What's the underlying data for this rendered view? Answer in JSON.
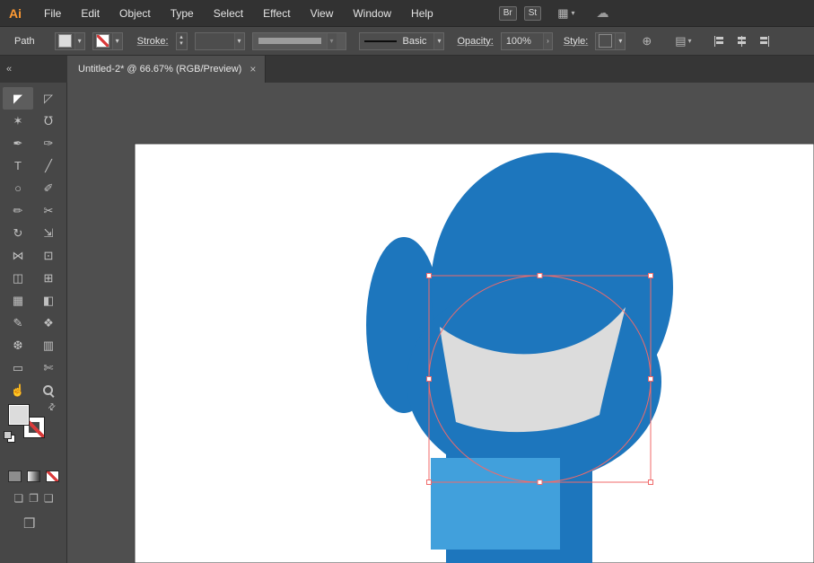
{
  "app": {
    "logo_text": "Ai"
  },
  "menubar": {
    "items": [
      {
        "label": "File"
      },
      {
        "label": "Edit"
      },
      {
        "label": "Object"
      },
      {
        "label": "Type"
      },
      {
        "label": "Select"
      },
      {
        "label": "Effect"
      },
      {
        "label": "View"
      },
      {
        "label": "Window"
      },
      {
        "label": "Help"
      }
    ],
    "buttons": [
      {
        "label": "Br"
      },
      {
        "label": "St"
      }
    ]
  },
  "controlbar": {
    "selection_label": "Path",
    "stroke_label": "Stroke:",
    "brush_label": "Basic",
    "opacity_label": "Opacity:",
    "opacity_value": "100%",
    "style_label": "Style:"
  },
  "tabbar": {
    "collapse_glyph": "«",
    "tab_title": "Untitled-2* @ 66.67% (RGB/Preview)",
    "close_glyph": "×"
  },
  "toolbar": {
    "tools": [
      {
        "name": "selection-tool",
        "glyph": "◤"
      },
      {
        "name": "direct-selection-tool",
        "glyph": "◸"
      },
      {
        "name": "magic-wand-tool",
        "glyph": "✶"
      },
      {
        "name": "lasso-tool",
        "glyph": "℧"
      },
      {
        "name": "pen-tool",
        "glyph": "✒"
      },
      {
        "name": "curvature-tool",
        "glyph": "✑"
      },
      {
        "name": "type-tool",
        "glyph": "T"
      },
      {
        "name": "line-segment-tool",
        "glyph": "╱"
      },
      {
        "name": "ellipse-tool",
        "glyph": "○"
      },
      {
        "name": "paintbrush-tool",
        "glyph": "✐"
      },
      {
        "name": "pencil-tool",
        "glyph": "✏"
      },
      {
        "name": "scissors-tool",
        "glyph": "✂"
      },
      {
        "name": "rotate-tool",
        "glyph": "↻"
      },
      {
        "name": "scale-tool",
        "glyph": "⇲"
      },
      {
        "name": "width-tool",
        "glyph": "⋈"
      },
      {
        "name": "free-transform-tool",
        "glyph": "⊡"
      },
      {
        "name": "shape-builder-tool",
        "glyph": "◫"
      },
      {
        "name": "perspective-grid-tool",
        "glyph": "⊞"
      },
      {
        "name": "mesh-tool",
        "glyph": "▦"
      },
      {
        "name": "gradient-tool",
        "glyph": "◧"
      },
      {
        "name": "eyedropper-tool",
        "glyph": "✎"
      },
      {
        "name": "blend-tool",
        "glyph": "❖"
      },
      {
        "name": "symbol-sprayer-tool",
        "glyph": "❆"
      },
      {
        "name": "column-graph-tool",
        "glyph": "▥"
      },
      {
        "name": "artboard-tool",
        "glyph": "▭"
      },
      {
        "name": "slice-tool",
        "glyph": "✄"
      },
      {
        "name": "hand-tool",
        "glyph": "☝"
      },
      {
        "name": "zoom-tool",
        "glyph": ""
      }
    ]
  },
  "icons": {
    "workspace": "▦",
    "sync": "☁",
    "chevron": "▾",
    "stepper_up": "▴",
    "stepper_down": "▾",
    "opacity_chevron": "›",
    "globe": "⊕",
    "document": "▤",
    "swap_colors": "⇄",
    "draw_normal": "❏",
    "draw_behind": "❐",
    "draw_inside": "❑",
    "screen_mode": "❒"
  },
  "colors": {
    "accent_orange": "#ff9a33",
    "glove_blue": "#1d76bd",
    "light_blue": "#41a0dc",
    "shape_gray": "#dcdcdc",
    "selection_red": "#f06a6a",
    "slash_red": "#d93a3a",
    "artboard_white": "#ffffff",
    "canvas_gray": "#4f4f4f"
  }
}
